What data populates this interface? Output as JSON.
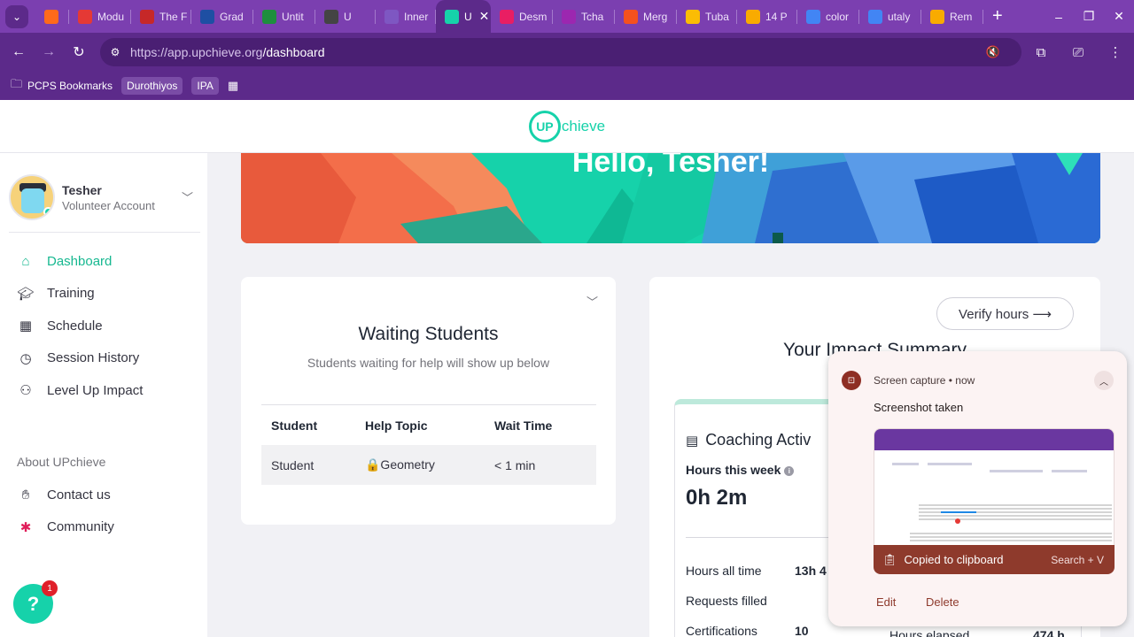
{
  "browser": {
    "tabs": [
      {
        "label": "",
        "icon": "flame-icon",
        "color": "#ff6a1a"
      },
      {
        "label": "Modu",
        "icon": "circle-icon",
        "color": "#e53935"
      },
      {
        "label": "The F",
        "icon": "bookmark-icon",
        "color": "#c62828"
      },
      {
        "label": "Grad",
        "icon": "sis-icon",
        "color": "#1e4fa3"
      },
      {
        "label": "Untit",
        "icon": "sheet-icon",
        "color": "#1e8e3e"
      },
      {
        "label": "U",
        "icon": "record-icon",
        "color": "#444444"
      },
      {
        "label": "Inner",
        "icon": "puzzle-icon",
        "color": "#7e57c2"
      },
      {
        "label": "U",
        "icon": "upchieve-icon",
        "color": "#16d2aa",
        "active": true
      },
      {
        "label": "Desm",
        "icon": "desmos-icon",
        "color": "#e91e63"
      },
      {
        "label": "Tcha",
        "icon": "flower-icon",
        "color": "#9c27b0"
      },
      {
        "label": "Merg",
        "icon": "arrow-icon",
        "color": "#f4511e"
      },
      {
        "label": "Tuba",
        "icon": "drive-icon",
        "color": "#fbbc04"
      },
      {
        "label": "14 P",
        "icon": "slides-icon",
        "color": "#f9ab00"
      },
      {
        "label": "color",
        "icon": "google-icon",
        "color": "#4285f4"
      },
      {
        "label": "utaly",
        "icon": "google-icon",
        "color": "#4285f4"
      },
      {
        "label": "Rem",
        "icon": "mortarboard-icon",
        "color": "#f9ab00"
      }
    ],
    "url_host": "https://app.upchieve.org",
    "url_path": "/dashboard",
    "bookmarks": {
      "folder": "PCPS Bookmarks",
      "chip1": "Durothiyos",
      "chip2": "IPA"
    }
  },
  "app": {
    "logo_circle": "UP",
    "logo_word": "chieve"
  },
  "profile": {
    "name": "Tesher",
    "role": "Volunteer Account"
  },
  "nav": {
    "items": [
      {
        "label": "Dashboard",
        "icon": "home-icon"
      },
      {
        "label": "Training",
        "icon": "graduation-cap-icon"
      },
      {
        "label": "Schedule",
        "icon": "calendar-icon"
      },
      {
        "label": "Session History",
        "icon": "clock-icon"
      },
      {
        "label": "Level Up Impact",
        "icon": "people-icon"
      }
    ],
    "about_heading": "About UPchieve",
    "about_items": [
      {
        "label": "Contact us",
        "icon": "wave-hand-icon"
      },
      {
        "label": "Community",
        "icon": "slack-icon"
      }
    ]
  },
  "banner": {
    "greeting": "Hello, Tesher!"
  },
  "waiting": {
    "title": "Waiting Students",
    "subtitle": "Students waiting for help will show up below",
    "headers": [
      "Student",
      "Help Topic",
      "Wait Time"
    ],
    "rows": [
      {
        "student": "Student",
        "topic": "🔒Geometry",
        "wait": "< 1 min"
      }
    ]
  },
  "impact": {
    "verify_label": "Verify hours ⟶",
    "title": "Your Impact Summary",
    "coaching_title": "Coaching Activ",
    "hours_week_label": "Hours this week",
    "hours_week_value": "0h 2m",
    "stats": [
      {
        "label": "Hours all time",
        "value": "13h 4"
      },
      {
        "label": "Requests filled",
        "value": ""
      },
      {
        "label": "Certifications",
        "value": "10"
      }
    ],
    "right_stat": {
      "label": "Hours elapsed",
      "value": "474 h"
    }
  },
  "help": {
    "badge": "1"
  },
  "notification": {
    "source": "Screen capture",
    "time": "now",
    "title": "Screenshot taken",
    "copied": "Copied to clipboard",
    "shortcut": "Search + V",
    "edit": "Edit",
    "delete": "Delete"
  },
  "colors": {
    "brand": "#16d2aa",
    "browser": "#5c2a8a",
    "notif_accent": "#8e3a2c"
  }
}
